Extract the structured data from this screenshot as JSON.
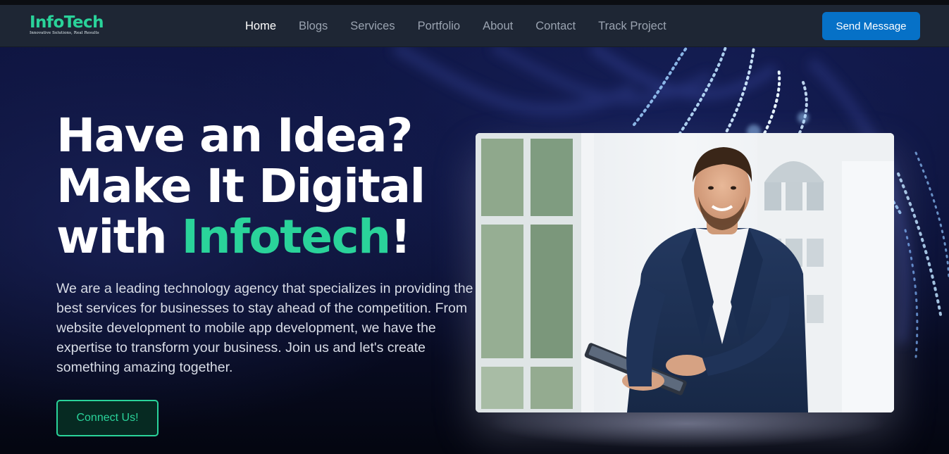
{
  "brand": {
    "name": "InfoTech",
    "tagline": "Innovative Solutions, Real Results"
  },
  "nav": {
    "items": [
      {
        "label": "Home",
        "active": true
      },
      {
        "label": "Blogs"
      },
      {
        "label": "Services"
      },
      {
        "label": "Portfolio"
      },
      {
        "label": "About"
      },
      {
        "label": "Contact"
      },
      {
        "label": "Track Project"
      }
    ],
    "cta_label": "Send Message"
  },
  "hero": {
    "headline_line1": "Have an Idea?",
    "headline_line2": "Make It Digital",
    "headline_line3_prefix": "with ",
    "headline_line3_accent": "Infotech",
    "headline_line3_suffix": "!",
    "description": "We are a leading technology agency that specializes in providing the best services for businesses to stay ahead of the competition. From website development to mobile app development, we have the expertise to transform your business. Join us and let's create something amazing together.",
    "cta_label": "Connect Us!",
    "image_icon": "businessman-with-tablet-photo"
  },
  "colors": {
    "accent": "#2ad39a",
    "primary_button": "#0671c7",
    "navbar_bg": "#1e2634",
    "hero_bg": "#0a0f2e"
  }
}
